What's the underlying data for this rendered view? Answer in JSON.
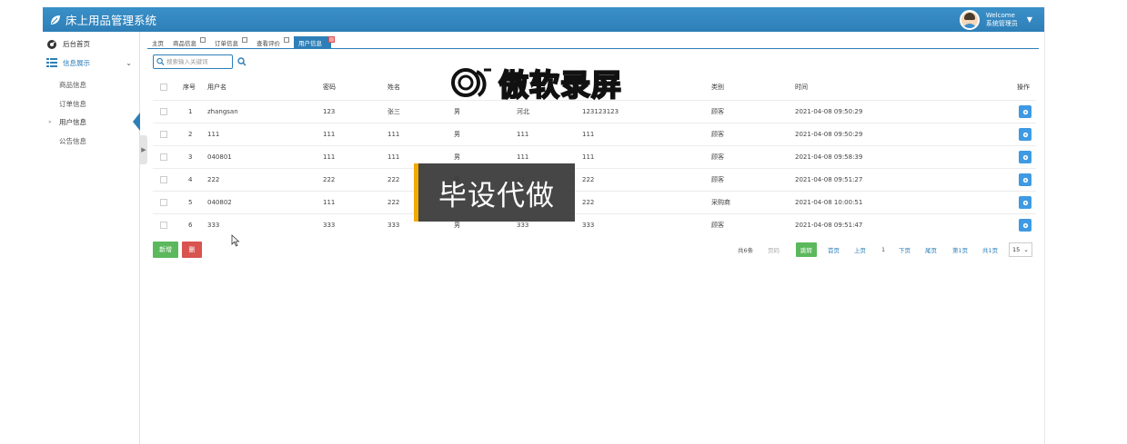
{
  "header": {
    "title": "床上用品管理系统",
    "welcome": "Welcome",
    "role": "系统管理员"
  },
  "sidebar": {
    "home": "后台首页",
    "group": "信息展示",
    "items": [
      "商品信息",
      "订单信息",
      "用户信息",
      "公告信息"
    ]
  },
  "tabs": [
    "主页",
    "商品信息",
    "订单信息",
    "查看评价",
    "用户信息"
  ],
  "search": {
    "placeholder": "搜索输入关键词"
  },
  "table": {
    "headers": [
      "序号",
      "用户名",
      "密码",
      "姓名",
      "",
      "",
      "",
      "类别",
      "时间",
      "操作"
    ],
    "rows": [
      [
        "1",
        "zhangsan",
        "123",
        "张三",
        "男",
        "河北",
        "123123123",
        "顾客",
        "2021-04-08 09:50:29"
      ],
      [
        "2",
        "111",
        "111",
        "111",
        "男",
        "111",
        "111",
        "顾客",
        "2021-04-08 09:50:29"
      ],
      [
        "3",
        "040801",
        "111",
        "111",
        "男",
        "111",
        "111",
        "顾客",
        "2021-04-08 09:58:39"
      ],
      [
        "4",
        "222",
        "222",
        "222",
        "男",
        "22",
        "222",
        "顾客",
        "2021-04-08 09:51:27"
      ],
      [
        "5",
        "040802",
        "111",
        "222",
        "",
        "",
        "222",
        "采购商",
        "2021-04-08 10:00:51"
      ],
      [
        "6",
        "333",
        "333",
        "333",
        "男",
        "333",
        "333",
        "顾客",
        "2021-04-08 09:51:47"
      ]
    ]
  },
  "buttons": {
    "add": "新增",
    "delete": "删"
  },
  "pager": {
    "total": "共6条",
    "input_placeholder": "页码",
    "jump": "跳转",
    "first": "首页",
    "prev": "上页",
    "current": "1",
    "next": "下页",
    "last": "尾页",
    "page_info": "第1页",
    "total_pages": "共1页",
    "page_size": "15"
  },
  "overlays": {
    "watermark": "傲软录屏",
    "ad": "毕设代做"
  },
  "colors": {
    "header": "#2e7fb8",
    "add_button": "#5cb85c",
    "delete_button": "#d9534f",
    "op_button": "#3f9ae3",
    "ad_accent": "#f2a900"
  }
}
